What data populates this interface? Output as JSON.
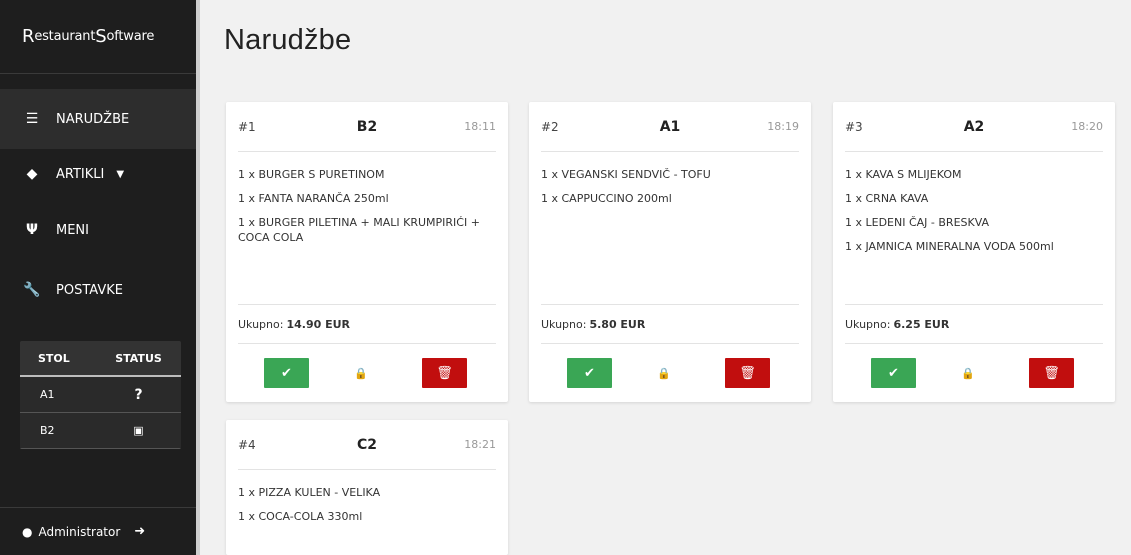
{
  "sidebar": {
    "brand_first_letter": "R",
    "brand_first_rest": "estaurant ",
    "brand_second_letter": "S",
    "brand_second_rest": "oftware",
    "nav": [
      {
        "label": "NARUDŽBE",
        "icon": "list-icon"
      },
      {
        "label": "ARTIKLI",
        "icon": "tags-icon"
      },
      {
        "label": "MENI",
        "icon": "utensils-icon"
      },
      {
        "label": "POSTAVKE",
        "icon": "wrench-icon"
      }
    ],
    "status_table": {
      "headers": [
        "STOL",
        "STATUS"
      ],
      "rows": [
        {
          "table": "A1",
          "status_glyph": "?",
          "status_icon": "question-icon"
        },
        {
          "table": "B2",
          "status_glyph": "▣",
          "status_icon": "money-bill-icon"
        }
      ]
    },
    "user": {
      "name": "Administrator",
      "icon": "user-icon",
      "logout_icon": "sign-out-icon"
    }
  },
  "main": {
    "title": "Narudžbe",
    "orders": [
      {
        "number": "#1",
        "table": "B2",
        "time": "18:11",
        "items": [
          "1 x BURGER S PURETINOM",
          "1 x FANTA NARANČA 250ml",
          "1 x BURGER PILETINA + MALI KRUMPIRIĆI + COCA COLA"
        ],
        "total_label": "Ukupno:",
        "total": "14.90 EUR"
      },
      {
        "number": "#2",
        "table": "A1",
        "time": "18:19",
        "items": [
          "1 x VEGANSKI SENDVIČ - TOFU",
          "1 x CAPPUCCINO 200ml"
        ],
        "total_label": "Ukupno:",
        "total": "5.80 EUR"
      },
      {
        "number": "#3",
        "table": "A2",
        "time": "18:20",
        "items": [
          "1 x KAVA S MLIJEKOM",
          "1 x CRNA KAVA",
          "1 x LEDENI ČAJ - BRESKVA",
          "1 x JAMNICA MINERALNA VODA 500ml"
        ],
        "total_label": "Ukupno:",
        "total": "6.25 EUR"
      },
      {
        "number": "#4",
        "table": "C2",
        "time": "18:21",
        "items": [
          "1 x PIZZA KULEN - VELIKA",
          "1 x COCA-COLA 330ml"
        ],
        "total_label": "",
        "total": ""
      }
    ],
    "action_icons": {
      "confirm": "check-icon",
      "lock": "lock-icon",
      "delete": "trash-icon"
    },
    "colors": {
      "confirm": "#3aa655",
      "delete": "#c10e0e",
      "sidebar": "#1e1e1e",
      "background": "#f1f1f1"
    }
  }
}
